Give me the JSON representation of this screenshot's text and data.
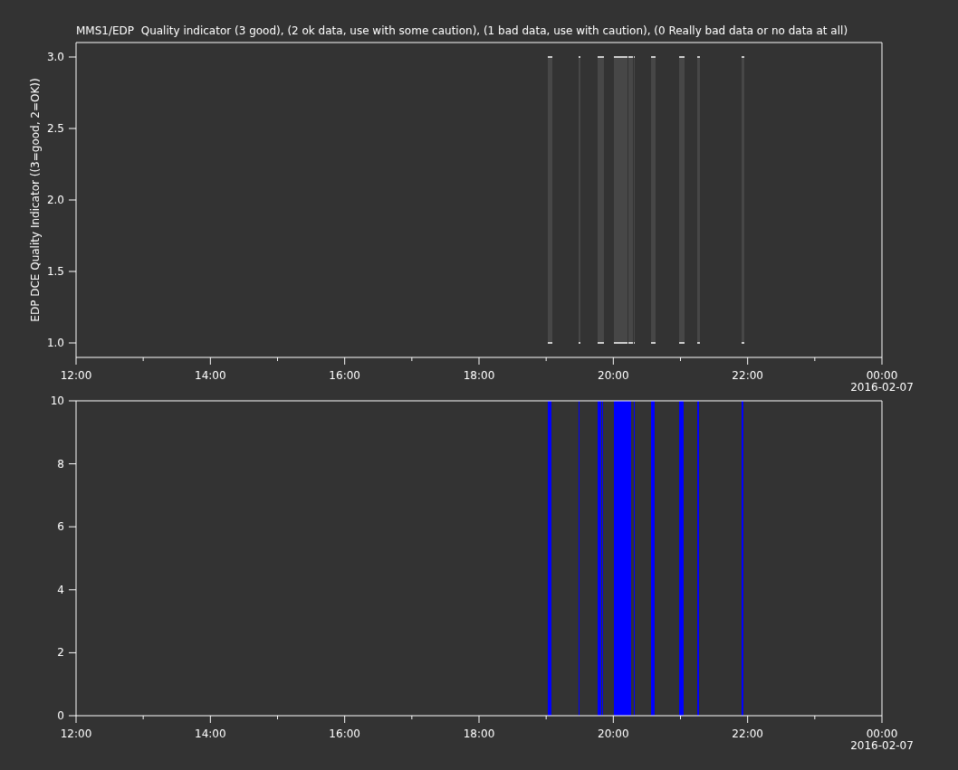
{
  "title": "MMS1/EDP  Quality indicator (3 good), (2 ok data, use with some caution), (1 bad data, use with caution), (0 Really bad data or no data at all)",
  "panels": [
    {
      "kind": "band",
      "color": "#474747",
      "ylabel": "EDP DCE Quality Indicator ((3=good, 2=OK))",
      "y_tick_labels": [
        "3.0",
        "2.5",
        "2.0",
        "1.5",
        "1.0"
      ],
      "x_tick_labels": [
        "12:00",
        "14:00",
        "16:00",
        "18:00",
        "20:00",
        "22:00",
        "00:00"
      ],
      "date_label": "2016-02-07"
    },
    {
      "kind": "bar",
      "color": "#0000ff",
      "y_tick_labels": [
        "10",
        "8",
        "6",
        "4",
        "2",
        "0"
      ],
      "x_tick_labels": [
        "12:00",
        "14:00",
        "16:00",
        "18:00",
        "20:00",
        "22:00",
        "00:00"
      ],
      "date_label": "2016-02-07"
    }
  ]
}
